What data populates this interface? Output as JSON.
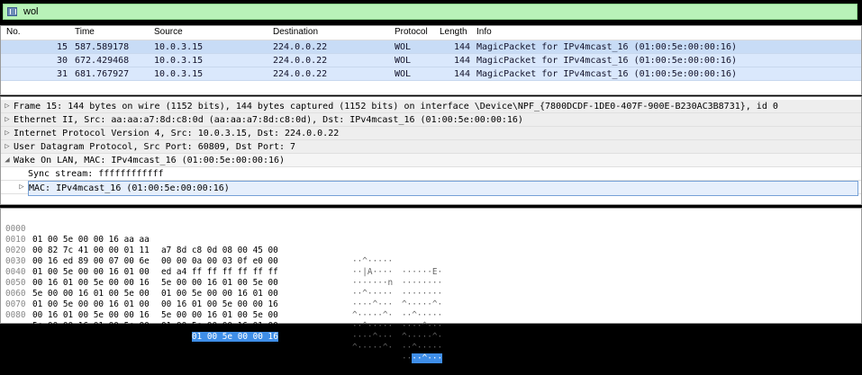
{
  "filter": {
    "value": "wol"
  },
  "packet_list": {
    "columns": [
      "No.",
      "Time",
      "Source",
      "Destination",
      "Protocol",
      "Length",
      "Info"
    ],
    "rows": [
      {
        "no": "15",
        "time": "587.589178",
        "source": "10.0.3.15",
        "destination": "224.0.0.22",
        "protocol": "WOL",
        "length": "144",
        "info": "MagicPacket for IPv4mcast_16 (01:00:5e:00:00:16)"
      },
      {
        "no": "30",
        "time": "672.429468",
        "source": "10.0.3.15",
        "destination": "224.0.0.22",
        "protocol": "WOL",
        "length": "144",
        "info": "MagicPacket for IPv4mcast_16 (01:00:5e:00:00:16)"
      },
      {
        "no": "31",
        "time": "681.767927",
        "source": "10.0.3.15",
        "destination": "224.0.0.22",
        "protocol": "WOL",
        "length": "144",
        "info": "MagicPacket for IPv4mcast_16 (01:00:5e:00:00:16)"
      }
    ]
  },
  "details": {
    "frame": "Frame 15: 144 bytes on wire (1152 bits), 144 bytes captured (1152 bits) on interface \\Device\\NPF_{7800DCDF-1DE0-407F-900E-B230AC3B8731}, id 0",
    "ethernet": "Ethernet II, Src: aa:aa:a7:8d:c8:0d (aa:aa:a7:8d:c8:0d), Dst: IPv4mcast_16 (01:00:5e:00:00:16)",
    "ip": "Internet Protocol Version 4, Src: 10.0.3.15, Dst: 224.0.0.22",
    "udp": "User Datagram Protocol, Src Port: 60809, Dst Port: 7",
    "wol": "Wake On LAN, MAC: IPv4mcast_16 (01:00:5e:00:00:16)",
    "sync": "Sync stream: ffffffffffff",
    "mac": "MAC: IPv4mcast_16 (01:00:5e:00:00:16)"
  },
  "bytes": [
    {
      "offset": "0000",
      "hex1": "01 00 5e 00 00 16 aa aa",
      "hex2": "a7 8d c8 0d 08 00 45 00",
      "ascii1": "··^·····",
      "ascii2": "······E·"
    },
    {
      "offset": "0010",
      "hex1": "00 82 7c 41 00 00 01 11",
      "hex2": "00 00 0a 00 03 0f e0 00",
      "ascii1": "··|A····",
      "ascii2": "········"
    },
    {
      "offset": "0020",
      "hex1": "00 16 ed 89 00 07 00 6e",
      "hex2": "ed a4 ff ff ff ff ff ff",
      "ascii1": "·······n",
      "ascii2": "········"
    },
    {
      "offset": "0030",
      "hex1": "01 00 5e 00 00 16 01 00",
      "hex2": "5e 00 00 16 01 00 5e 00",
      "ascii1": "··^·····",
      "ascii2": "^·····^·"
    },
    {
      "offset": "0040",
      "hex1": "00 16 01 00 5e 00 00 16",
      "hex2": "01 00 5e 00 00 16 01 00",
      "ascii1": "····^···",
      "ascii2": "··^·····"
    },
    {
      "offset": "0050",
      "hex1": "5e 00 00 16 01 00 5e 00",
      "hex2": "00 16 01 00 5e 00 00 16",
      "ascii1": "^·····^·",
      "ascii2": "····^···"
    },
    {
      "offset": "0060",
      "hex1": "01 00 5e 00 00 16 01 00",
      "hex2": "5e 00 00 16 01 00 5e 00",
      "ascii1": "··^·····",
      "ascii2": "^·····^·"
    },
    {
      "offset": "0070",
      "hex1": "00 16 01 00 5e 00 00 16",
      "hex2": "01 00 5e 00 00 16 01 00",
      "ascii1": "····^···",
      "ascii2": "··^·····"
    },
    {
      "offset": "0080",
      "hex1": "5e 00 00 16 01 00 5e 00",
      "hex2_plain": "00 16",
      "hex2_sel": "01 00 5e 00 00 16",
      "ascii1": "^·····^·",
      "ascii2_plain": "··",
      "ascii2_sel": "··^···"
    }
  ]
}
